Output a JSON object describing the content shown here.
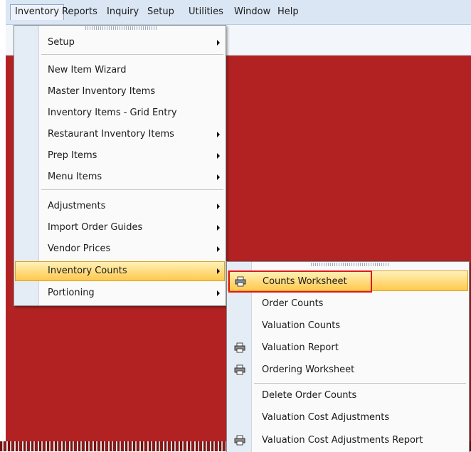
{
  "menubar": {
    "items": [
      "Inventory",
      "Reports",
      "Inquiry",
      "Setup",
      "Utilities",
      "Window",
      "Help"
    ]
  },
  "inventory_menu": {
    "items": [
      {
        "label": "Setup",
        "submenu": true
      },
      {
        "label": "New Item Wizard",
        "submenu": false
      },
      {
        "label": "Master Inventory Items",
        "submenu": false
      },
      {
        "label": "Inventory Items - Grid Entry",
        "submenu": false
      },
      {
        "label": "Restaurant Inventory Items",
        "submenu": true
      },
      {
        "label": "Prep Items",
        "submenu": true
      },
      {
        "label": "Menu Items",
        "submenu": true
      },
      {
        "label": "Adjustments",
        "submenu": true
      },
      {
        "label": "Import Order Guides",
        "submenu": true
      },
      {
        "label": "Vendor Prices",
        "submenu": true
      },
      {
        "label": "Inventory Counts",
        "submenu": true,
        "highlighted": true
      },
      {
        "label": "Portioning",
        "submenu": true
      }
    ]
  },
  "counts_submenu": {
    "items": [
      {
        "label": "Counts Worksheet",
        "icon": "printer-icon",
        "highlighted": true
      },
      {
        "label": "Order Counts"
      },
      {
        "label": "Valuation Counts"
      },
      {
        "label": "Valuation Report",
        "icon": "printer-icon"
      },
      {
        "label": "Ordering Worksheet",
        "icon": "printer-icon"
      },
      {
        "label": "Delete Order Counts"
      },
      {
        "label": "Valuation Cost Adjustments"
      },
      {
        "label": "Valuation Cost Adjustments Report",
        "icon": "printer-icon"
      }
    ]
  },
  "colors": {
    "background_red": "#b22222",
    "highlight": "#ffc94d",
    "focus_outline": "#e0191b",
    "menubar": "#dbe6f4"
  }
}
